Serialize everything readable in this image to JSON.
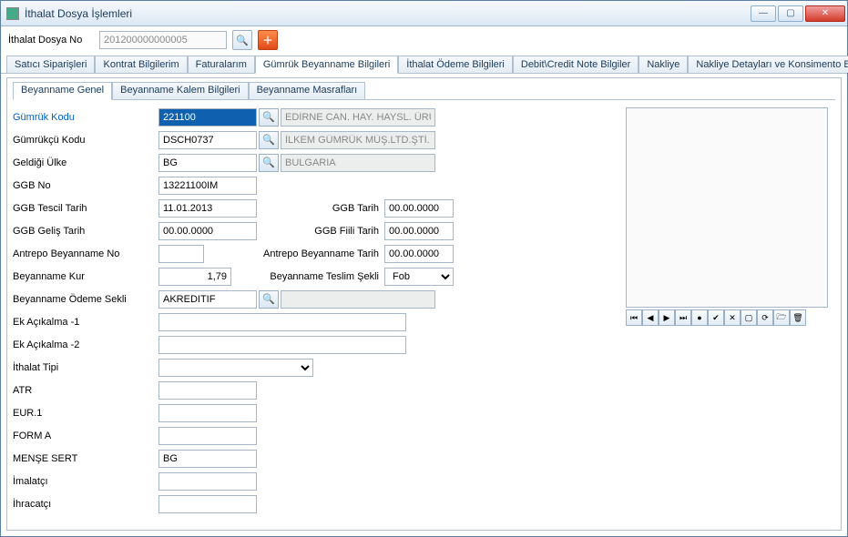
{
  "window": {
    "title": "İthalat Dosya İşlemleri"
  },
  "toolbar": {
    "dosya_no_label": "İthalat Dosya No",
    "dosya_no_value": "201200000000005"
  },
  "tabs_main": {
    "items": [
      "Satıcı Siparişleri",
      "Kontrat Bilgilerim",
      "Faturalarım",
      "Gümrük Beyanname Bilgileri",
      "İthalat Ödeme Bilgileri",
      "Debit\\Credit Note Bilgiler",
      "Nakliye",
      "Nakliye Detayları ve Konsimento Bilgileri"
    ],
    "active_index": 3
  },
  "tabs_sub": {
    "items": [
      "Beyanname Genel",
      "Beyanname Kalem Bilgileri",
      "Beyanname Masrafları"
    ],
    "active_index": 0
  },
  "form": {
    "gumruk_kodu_label": "Gümrük Kodu",
    "gumruk_kodu": "221100",
    "gumruk_kodu_desc": "EDİRNE CAN. HAY. HAYSL. ÜRÜ. İHT.",
    "gumrukcu_kodu_label": "Gümrükçü Kodu",
    "gumrukcu_kodu": "DSCH0737",
    "gumrukcu_kodu_desc": "İLKEM GÜMRÜK MÜŞ.LTD.ŞTİ.",
    "geldigi_ulke_label": "Geldiği Ülke",
    "geldigi_ulke": "BG",
    "geldigi_ulke_desc": "BULGARIA",
    "ggb_no_label": "GGB No",
    "ggb_no": "13221100IM",
    "ggb_tescil_tarih_label": "GGB Tescil Tarih",
    "ggb_tescil_tarih": "11.01.2013",
    "ggb_tarih_label": "GGB Tarih",
    "ggb_tarih": "00.00.0000",
    "ggb_gelis_tarih_label": "GGB Geliş Tarih",
    "ggb_gelis_tarih": "00.00.0000",
    "ggb_fiili_tarih_label": "GGB Fiili Tarih",
    "ggb_fiili_tarih": "00.00.0000",
    "antrepo_no_label": "Antrepo Beyanname No",
    "antrepo_no": "",
    "antrepo_tarih_label": "Antrepo Beyanname Tarih",
    "antrepo_tarih": "00.00.0000",
    "beyanname_kur_label": "Beyanname Kur",
    "beyanname_kur": "1,79",
    "teslim_sekli_label": "Beyanname Teslim Şekli",
    "teslim_sekli": "Fob",
    "odeme_sekli_label": "Beyanname Ödeme Sekli",
    "odeme_sekli": "AKREDITIF",
    "odeme_sekli_desc": "",
    "ek_acikalma1_label": "Ek Açıkalma -1",
    "ek_acikalma1": "",
    "ek_acikalma2_label": "Ek Açıkalma -2",
    "ek_acikalma2": "",
    "ithalat_tipi_label": "İthalat Tipi",
    "ithalat_tipi": "",
    "atr_label": "ATR",
    "atr": "",
    "eur1_label": "EUR.1",
    "eur1": "",
    "forma_label": "FORM A",
    "forma": "",
    "mense_label": "MENŞE SERT",
    "mense": "BG",
    "imalatci_label": "İmalatçı",
    "imalatci": "",
    "ihracatci_label": "İhracatçı",
    "ihracatci": ""
  },
  "nav_icons": [
    "⏮",
    "◀",
    "▶",
    "⏭",
    "●",
    "✔",
    "✕",
    "▢",
    "⟳",
    "🗁",
    "🗑"
  ]
}
